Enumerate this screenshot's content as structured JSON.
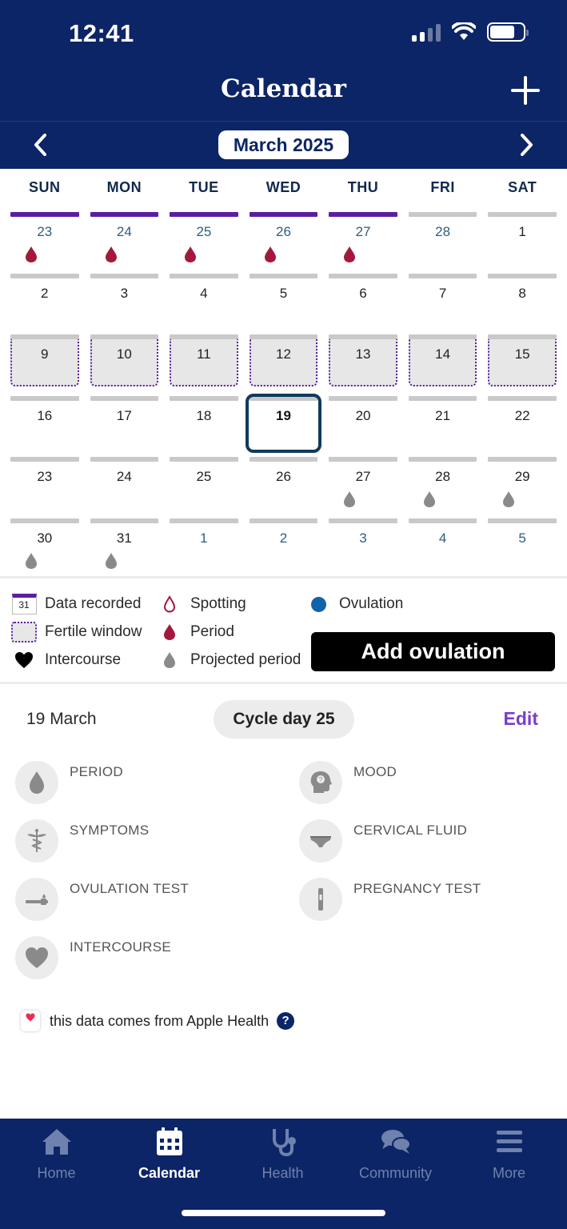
{
  "status_bar": {
    "time": "12:41"
  },
  "header": {
    "title": "Calendar",
    "month": "March 2025"
  },
  "calendar": {
    "weekdays": [
      "SUN",
      "MON",
      "TUE",
      "WED",
      "THU",
      "FRI",
      "SAT"
    ],
    "weeks": [
      [
        {
          "d": "23",
          "other": true,
          "rec": true,
          "drop": "period"
        },
        {
          "d": "24",
          "other": true,
          "rec": true,
          "drop": "period"
        },
        {
          "d": "25",
          "other": true,
          "rec": true,
          "drop": "period"
        },
        {
          "d": "26",
          "other": true,
          "rec": true,
          "drop": "period"
        },
        {
          "d": "27",
          "other": true,
          "rec": true,
          "drop": "period"
        },
        {
          "d": "28",
          "other": true
        },
        {
          "d": "1"
        }
      ],
      [
        {
          "d": "2"
        },
        {
          "d": "3"
        },
        {
          "d": "4"
        },
        {
          "d": "5"
        },
        {
          "d": "6"
        },
        {
          "d": "7"
        },
        {
          "d": "8"
        }
      ],
      [
        {
          "d": "9",
          "fertile": true
        },
        {
          "d": "10",
          "fertile": true
        },
        {
          "d": "11",
          "fertile": true
        },
        {
          "d": "12",
          "fertile": true
        },
        {
          "d": "13",
          "fertile": true
        },
        {
          "d": "14",
          "fertile": true
        },
        {
          "d": "15",
          "fertile": true
        }
      ],
      [
        {
          "d": "16"
        },
        {
          "d": "17"
        },
        {
          "d": "18"
        },
        {
          "d": "19",
          "today": true
        },
        {
          "d": "20"
        },
        {
          "d": "21"
        },
        {
          "d": "22"
        }
      ],
      [
        {
          "d": "23"
        },
        {
          "d": "24"
        },
        {
          "d": "25"
        },
        {
          "d": "26"
        },
        {
          "d": "27",
          "drop": "projected"
        },
        {
          "d": "28",
          "drop": "projected"
        },
        {
          "d": "29",
          "drop": "projected"
        }
      ],
      [
        {
          "d": "30",
          "drop": "projected"
        },
        {
          "d": "31",
          "drop": "projected"
        },
        {
          "d": "1",
          "other": true
        },
        {
          "d": "2",
          "other": true
        },
        {
          "d": "3",
          "other": true
        },
        {
          "d": "4",
          "other": true
        },
        {
          "d": "5",
          "other": true
        }
      ]
    ]
  },
  "legend": {
    "data_recorded": "Data recorded",
    "data_recorded_icon_num": "31",
    "fertile_window": "Fertile window",
    "intercourse": "Intercourse",
    "spotting": "Spotting",
    "period": "Period",
    "projected_period": "Projected period",
    "ovulation": "Ovulation",
    "add_ovulation": "Add ovulation"
  },
  "day_detail": {
    "date": "19 March",
    "cycle_day": "Cycle day 25",
    "edit": "Edit",
    "categories": [
      {
        "label": "PERIOD",
        "icon": "drop-icon"
      },
      {
        "label": "MOOD",
        "icon": "head-icon"
      },
      {
        "label": "SYMPTOMS",
        "icon": "caduceus-icon"
      },
      {
        "label": "CERVICAL FLUID",
        "icon": "underwear-icon"
      },
      {
        "label": "OVULATION TEST",
        "icon": "test-strip-icon"
      },
      {
        "label": "PREGNANCY TEST",
        "icon": "pregnancy-test-icon"
      },
      {
        "label": "INTERCOURSE",
        "icon": "heart-icon"
      }
    ],
    "health_note": "this data comes from Apple Health"
  },
  "tabs": [
    {
      "label": "Home",
      "icon": "home-icon"
    },
    {
      "label": "Calendar",
      "icon": "calendar-icon",
      "active": true
    },
    {
      "label": "Health",
      "icon": "stethoscope-icon"
    },
    {
      "label": "Community",
      "icon": "chat-bubbles-icon"
    },
    {
      "label": "More",
      "icon": "menu-icon"
    }
  ],
  "colors": {
    "primary_navy": "#0c2566",
    "recorded_purple": "#5b1ea3",
    "period_red": "#a3193d",
    "projected_gray": "#8a8a8a",
    "ovulation_blue": "#0f63a8",
    "edit_purple": "#7a3dc8"
  }
}
